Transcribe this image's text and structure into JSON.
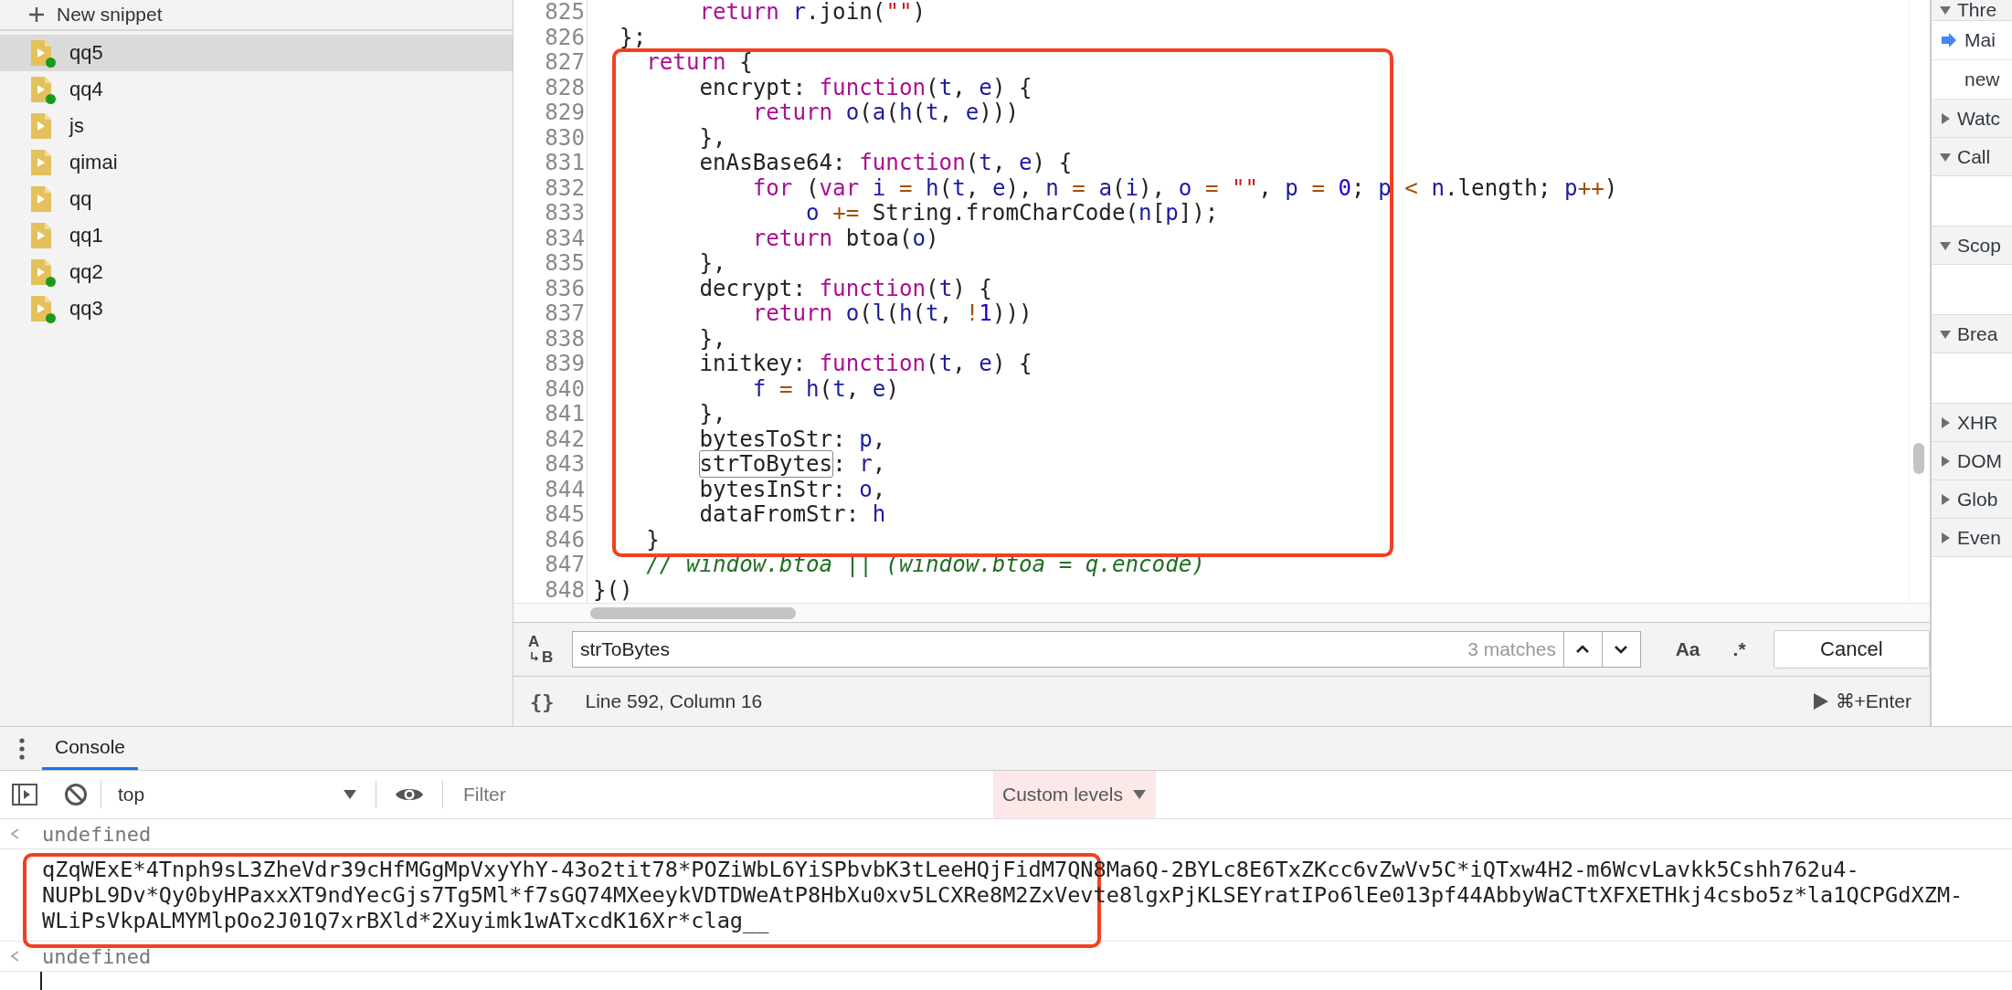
{
  "sidebar": {
    "new_snippet": "New snippet",
    "items": [
      {
        "name": "qq5",
        "selected": true,
        "running": true
      },
      {
        "name": "qq4",
        "selected": false,
        "running": true
      },
      {
        "name": "js",
        "selected": false,
        "running": false
      },
      {
        "name": "qimai",
        "selected": false,
        "running": false
      },
      {
        "name": "qq",
        "selected": false,
        "running": false
      },
      {
        "name": "qq1",
        "selected": false,
        "running": false
      },
      {
        "name": "qq2",
        "selected": false,
        "running": true
      },
      {
        "name": "qq3",
        "selected": false,
        "running": true
      }
    ]
  },
  "editor": {
    "lines": [
      {
        "number": "825",
        "tokens": [
          {
            "text": "        return ",
            "kind": "keyword"
          },
          {
            "text": "r",
            "kind": "variable"
          },
          {
            "text": ".join(",
            "kind": "plain"
          },
          {
            "text": "\"\"",
            "kind": "string"
          },
          {
            "text": ")",
            "kind": "plain"
          }
        ]
      },
      {
        "number": "826",
        "tokens": [
          {
            "text": "  };",
            "kind": "plain"
          }
        ]
      },
      {
        "number": "827",
        "tokens": [
          {
            "text": "    return",
            "kind": "keyword"
          },
          {
            "text": " {",
            "kind": "plain"
          }
        ]
      },
      {
        "number": "828",
        "tokens": [
          {
            "text": "        encrypt: ",
            "kind": "plain"
          },
          {
            "text": "function",
            "kind": "keyword"
          },
          {
            "text": "(",
            "kind": "plain"
          },
          {
            "text": "t",
            "kind": "variable"
          },
          {
            "text": ", ",
            "kind": "plain"
          },
          {
            "text": "e",
            "kind": "variable"
          },
          {
            "text": ") {",
            "kind": "plain"
          }
        ]
      },
      {
        "number": "829",
        "tokens": [
          {
            "text": "            return ",
            "kind": "keyword"
          },
          {
            "text": "o",
            "kind": "variable"
          },
          {
            "text": "(",
            "kind": "plain"
          },
          {
            "text": "a",
            "kind": "variable"
          },
          {
            "text": "(",
            "kind": "plain"
          },
          {
            "text": "h",
            "kind": "variable"
          },
          {
            "text": "(",
            "kind": "plain"
          },
          {
            "text": "t",
            "kind": "variable"
          },
          {
            "text": ", ",
            "kind": "plain"
          },
          {
            "text": "e",
            "kind": "variable"
          },
          {
            "text": ")))",
            "kind": "plain"
          }
        ]
      },
      {
        "number": "830",
        "tokens": [
          {
            "text": "        },",
            "kind": "plain"
          }
        ]
      },
      {
        "number": "831",
        "tokens": [
          {
            "text": "        enAsBase64: ",
            "kind": "plain"
          },
          {
            "text": "function",
            "kind": "keyword"
          },
          {
            "text": "(",
            "kind": "plain"
          },
          {
            "text": "t",
            "kind": "variable"
          },
          {
            "text": ", ",
            "kind": "plain"
          },
          {
            "text": "e",
            "kind": "variable"
          },
          {
            "text": ") {",
            "kind": "plain"
          }
        ]
      },
      {
        "number": "832",
        "tokens": [
          {
            "text": "            for",
            "kind": "keyword"
          },
          {
            "text": " (",
            "kind": "plain"
          },
          {
            "text": "var ",
            "kind": "keyword"
          },
          {
            "text": "i ",
            "kind": "variable"
          },
          {
            "text": "= ",
            "kind": "operator"
          },
          {
            "text": "h",
            "kind": "variable"
          },
          {
            "text": "(",
            "kind": "plain"
          },
          {
            "text": "t",
            "kind": "variable"
          },
          {
            "text": ", ",
            "kind": "plain"
          },
          {
            "text": "e",
            "kind": "variable"
          },
          {
            "text": "), ",
            "kind": "plain"
          },
          {
            "text": "n ",
            "kind": "variable"
          },
          {
            "text": "= ",
            "kind": "operator"
          },
          {
            "text": "a",
            "kind": "variable"
          },
          {
            "text": "(",
            "kind": "plain"
          },
          {
            "text": "i",
            "kind": "variable"
          },
          {
            "text": "), ",
            "kind": "plain"
          },
          {
            "text": "o ",
            "kind": "variable"
          },
          {
            "text": "= ",
            "kind": "operator"
          },
          {
            "text": "\"\"",
            "kind": "string"
          },
          {
            "text": ", ",
            "kind": "plain"
          },
          {
            "text": "p ",
            "kind": "variable"
          },
          {
            "text": "= ",
            "kind": "operator"
          },
          {
            "text": "0",
            "kind": "number"
          },
          {
            "text": "; ",
            "kind": "plain"
          },
          {
            "text": "p ",
            "kind": "variable"
          },
          {
            "text": "< ",
            "kind": "operator"
          },
          {
            "text": "n",
            "kind": "variable"
          },
          {
            "text": ".length; ",
            "kind": "plain"
          },
          {
            "text": "p",
            "kind": "variable"
          },
          {
            "text": "++",
            "kind": "operator"
          },
          {
            "text": ")",
            "kind": "plain"
          }
        ]
      },
      {
        "number": "833",
        "tokens": [
          {
            "text": "                o ",
            "kind": "variable"
          },
          {
            "text": "+=",
            "kind": "operator"
          },
          {
            "text": " String.fromCharCode(",
            "kind": "plain"
          },
          {
            "text": "n",
            "kind": "variable"
          },
          {
            "text": "[",
            "kind": "plain"
          },
          {
            "text": "p",
            "kind": "variable"
          },
          {
            "text": "]);",
            "kind": "plain"
          }
        ]
      },
      {
        "number": "834",
        "tokens": [
          {
            "text": "            return",
            "kind": "keyword"
          },
          {
            "text": " btoa(",
            "kind": "plain"
          },
          {
            "text": "o",
            "kind": "variable"
          },
          {
            "text": ")",
            "kind": "plain"
          }
        ]
      },
      {
        "number": "835",
        "tokens": [
          {
            "text": "        },",
            "kind": "plain"
          }
        ]
      },
      {
        "number": "836",
        "tokens": [
          {
            "text": "        decrypt: ",
            "kind": "plain"
          },
          {
            "text": "function",
            "kind": "keyword"
          },
          {
            "text": "(",
            "kind": "plain"
          },
          {
            "text": "t",
            "kind": "variable"
          },
          {
            "text": ") {",
            "kind": "plain"
          }
        ]
      },
      {
        "number": "837",
        "tokens": [
          {
            "text": "            return ",
            "kind": "keyword"
          },
          {
            "text": "o",
            "kind": "variable"
          },
          {
            "text": "(",
            "kind": "plain"
          },
          {
            "text": "l",
            "kind": "variable"
          },
          {
            "text": "(",
            "kind": "plain"
          },
          {
            "text": "h",
            "kind": "variable"
          },
          {
            "text": "(",
            "kind": "plain"
          },
          {
            "text": "t",
            "kind": "variable"
          },
          {
            "text": ", ",
            "kind": "plain"
          },
          {
            "text": "!",
            "kind": "operator"
          },
          {
            "text": "1",
            "kind": "number"
          },
          {
            "text": ")))",
            "kind": "plain"
          }
        ]
      },
      {
        "number": "838",
        "tokens": [
          {
            "text": "        },",
            "kind": "plain"
          }
        ]
      },
      {
        "number": "839",
        "tokens": [
          {
            "text": "        initkey: ",
            "kind": "plain"
          },
          {
            "text": "function",
            "kind": "keyword"
          },
          {
            "text": "(",
            "kind": "plain"
          },
          {
            "text": "t",
            "kind": "variable"
          },
          {
            "text": ", ",
            "kind": "plain"
          },
          {
            "text": "e",
            "kind": "variable"
          },
          {
            "text": ") {",
            "kind": "plain"
          }
        ]
      },
      {
        "number": "840",
        "tokens": [
          {
            "text": "            f ",
            "kind": "variable"
          },
          {
            "text": "= ",
            "kind": "operator"
          },
          {
            "text": "h",
            "kind": "variable"
          },
          {
            "text": "(",
            "kind": "plain"
          },
          {
            "text": "t",
            "kind": "variable"
          },
          {
            "text": ", ",
            "kind": "plain"
          },
          {
            "text": "e",
            "kind": "variable"
          },
          {
            "text": ")",
            "kind": "plain"
          }
        ]
      },
      {
        "number": "841",
        "tokens": [
          {
            "text": "        },",
            "kind": "plain"
          }
        ]
      },
      {
        "number": "842",
        "tokens": [
          {
            "text": "        bytesToStr: ",
            "kind": "plain"
          },
          {
            "text": "p",
            "kind": "variable"
          },
          {
            "text": ",",
            "kind": "plain"
          }
        ]
      },
      {
        "number": "843",
        "tokens": [
          {
            "text": "        strToBytes",
            "kind": "match"
          },
          {
            "text": ": ",
            "kind": "plain"
          },
          {
            "text": "r",
            "kind": "variable"
          },
          {
            "text": ",",
            "kind": "plain"
          }
        ]
      },
      {
        "number": "844",
        "tokens": [
          {
            "text": "        bytesInStr: ",
            "kind": "plain"
          },
          {
            "text": "o",
            "kind": "variable"
          },
          {
            "text": ",",
            "kind": "plain"
          }
        ]
      },
      {
        "number": "845",
        "tokens": [
          {
            "text": "        dataFromStr: ",
            "kind": "plain"
          },
          {
            "text": "h",
            "kind": "variable"
          }
        ]
      },
      {
        "number": "846",
        "tokens": [
          {
            "text": "    }",
            "kind": "plain"
          }
        ]
      },
      {
        "number": "847",
        "tokens": [
          {
            "text": "    // window.btoa || (window.btoa = q.encode)",
            "kind": "comment"
          }
        ]
      },
      {
        "number": "848",
        "tokens": [
          {
            "text": "}()",
            "kind": "plain"
          }
        ]
      }
    ]
  },
  "search_bar": {
    "replace_toggle": {
      "top": "A",
      "bottom": "B"
    },
    "query": "strToBytes",
    "match_count": "3 matches",
    "case_toggle": "Aa",
    "regex_toggle": ".*",
    "cancel": "Cancel"
  },
  "status_bar": {
    "format_button": "{}",
    "position": "Line 592, Column 16",
    "run_hint": "⌘+Enter"
  },
  "debugger_panel": {
    "sections": [
      {
        "label": "Thre",
        "expanded": true,
        "threads": [
          {
            "label": "Mai",
            "current": true
          },
          {
            "label": "new",
            "current": false
          }
        ]
      },
      {
        "label": "Watc",
        "expanded": false
      },
      {
        "label": "Call",
        "expanded": true
      },
      {
        "label": "Scop",
        "expanded": true
      },
      {
        "label": "Brea",
        "expanded": true
      },
      {
        "label": "XHR",
        "expanded": false
      },
      {
        "label": "DOM",
        "expanded": false
      },
      {
        "label": "Glob",
        "expanded": false
      },
      {
        "label": "Even",
        "expanded": false
      }
    ]
  },
  "drawer": {
    "tabs": [
      {
        "label": "Console",
        "selected": true
      }
    ],
    "toolbar": {
      "context": "top",
      "filter_placeholder": "Filter",
      "levels": "Custom levels"
    },
    "messages": [
      {
        "kind": "result",
        "text": "undefined"
      },
      {
        "kind": "log",
        "lines": [
          "qZqWExE*4Tnph9sL3ZheVdr39cHfMGgMpVxyYhY-43o2tit78*POZiWbL6YiSPbvbK3tLeeHQjFidM7QN8Ma6Q-2BYLc8E6TxZKcc6vZwVv5C*iQTxw4H2-m6WcvLavkk5Cshh762u4-",
          "NUPbL9Dv*Qy0byHPaxxXT9ndYecGjs7Tg5Ml*f7sGQ74MXeeykVDTDWeAtP8HbXu0xv5LCXRe8M2ZxVevte8lgxPjKLSEYratIPo6lEe013pf44AbbyWaCTtXFXETHkj4csbo5z*la1QCPGdXZM-",
          "WLiPsVkpALMYMlpOo2J01Q7xrBXld*2Xuyimk1wATxcdK16Xr*clag__"
        ]
      },
      {
        "kind": "result",
        "text": "undefined"
      },
      {
        "kind": "prompt"
      }
    ]
  }
}
